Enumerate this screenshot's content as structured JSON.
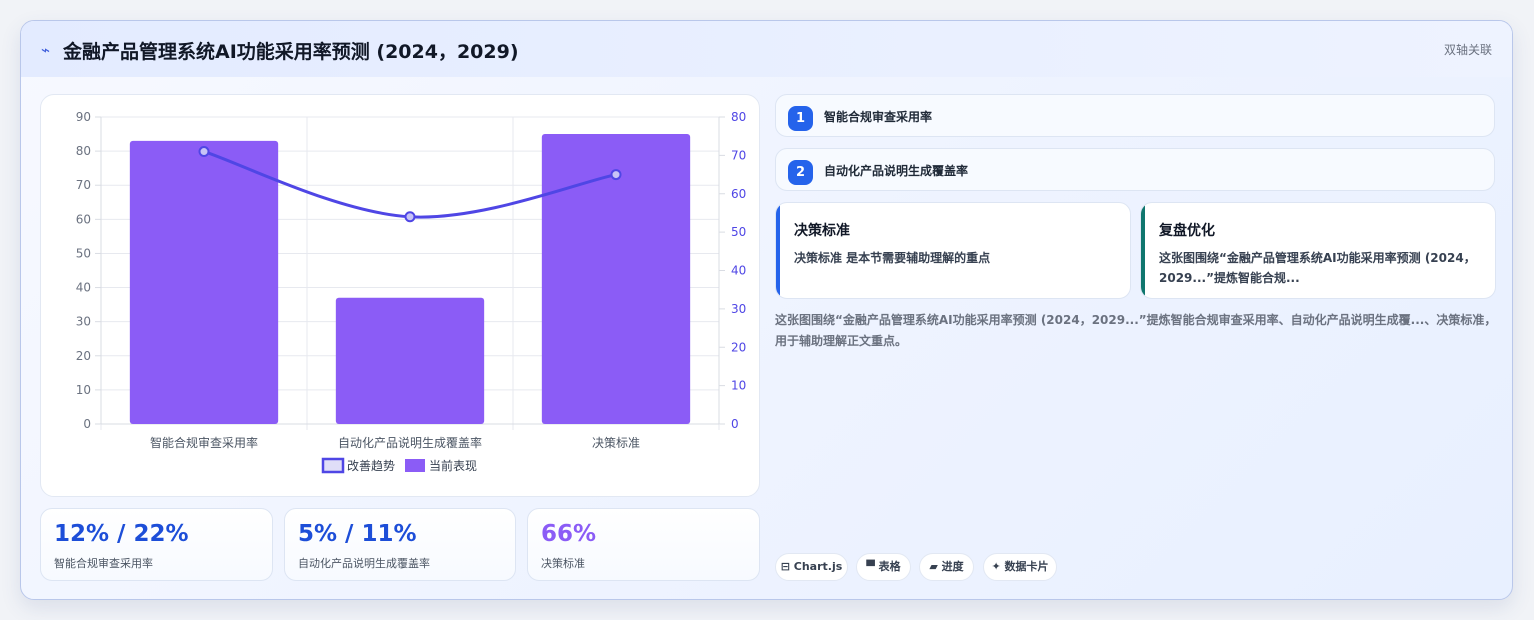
{
  "header": {
    "icon": "bolt-icon",
    "title": "金融产品管理系统AI功能采用率预测 (2024，2029)",
    "tag": "双轴关联"
  },
  "chart_data": {
    "type": "bar",
    "categories": [
      "智能合规审查采用率",
      "自动化产品说明生成覆盖率",
      "决策标准"
    ],
    "series": [
      {
        "name": "当前表现",
        "type": "bar",
        "axis": "left",
        "values": [
          83,
          37,
          85
        ],
        "color": "#8b5cf6"
      },
      {
        "name": "改善趋势",
        "type": "line",
        "axis": "right",
        "values": [
          71,
          54,
          65
        ],
        "color": "#4f46e5"
      }
    ],
    "y_left": {
      "ticks": [
        "0",
        "10",
        "20",
        "30",
        "40",
        "50",
        "60",
        "70",
        "80",
        "90"
      ],
      "range": [
        0,
        90
      ]
    },
    "y_right": {
      "ticks": [
        "0",
        "10",
        "20",
        "30",
        "40",
        "50",
        "60",
        "70",
        "80"
      ],
      "range": [
        0,
        80
      ]
    },
    "legend": {
      "placement": "bottom",
      "items": [
        "改善趋势",
        "当前表现"
      ]
    },
    "grid": true
  },
  "kpis": [
    {
      "value": "12% / 22%",
      "label": "智能合规审查采用率",
      "color": "#1d4ed8"
    },
    {
      "value": "5% / 11%",
      "label": "自动化产品说明生成覆盖率",
      "color": "#1d4ed8"
    },
    {
      "value": "66%",
      "label": "决策标准",
      "color": "#8b5cf6"
    }
  ],
  "steps": [
    {
      "num": "1",
      "text": "智能合规审查采用率"
    },
    {
      "num": "2",
      "text": "自动化产品说明生成覆盖率"
    }
  ],
  "notes": [
    {
      "title": "决策标准",
      "body": "决策标准 是本节需要辅助理解的重点",
      "accent": "#2563eb"
    },
    {
      "title": "复盘优化",
      "body": "这张图围绕“金融产品管理系统AI功能采用率预测 (2024，2029...”提炼智能合规...",
      "accent": "#0f766e"
    }
  ],
  "summary": "这张图围绕“金融产品管理系统AI功能采用率预测 (2024，2029...”提炼智能合规审查采用率、自动化产品说明生成覆...、决策标准，用于辅助理解正文重点。",
  "chips": [
    {
      "icon": "chart-icon",
      "glyph": "⊟",
      "label": "Chart.js"
    },
    {
      "icon": "table-icon",
      "glyph": "▀",
      "label": "表格"
    },
    {
      "icon": "progress-icon",
      "glyph": "▰",
      "label": "进度"
    },
    {
      "icon": "sparkle-icon",
      "glyph": "✦",
      "label": "数据卡片"
    }
  ]
}
